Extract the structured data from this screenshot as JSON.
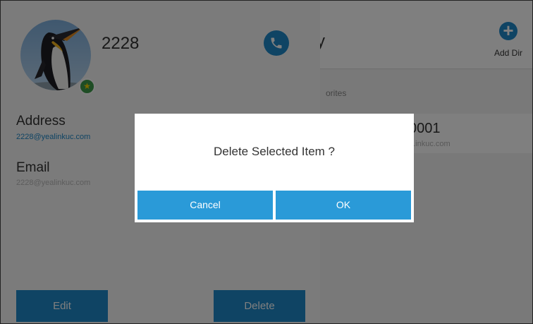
{
  "contact": {
    "name": "2228",
    "address_label": "Address",
    "address_value": "2228@yealinkuc.com",
    "email_label": "Email",
    "email_value": "2228@yealinkuc.com"
  },
  "actions": {
    "edit_label": "Edit",
    "delete_label": "Delete"
  },
  "directory": {
    "title_fragment": "ry",
    "add_label": "Add Dir",
    "tab_fragment": "orites",
    "entry_number_fragment": "0001",
    "entry_sub_fragment": "...inkuc.com"
  },
  "dialog": {
    "message": "Delete Selected Item ?",
    "cancel_label": "Cancel",
    "ok_label": "OK"
  },
  "colors": {
    "accent": "#1e88c8",
    "dialog_button": "#2a9ad8",
    "favorite_badge": "#3d9a4a"
  },
  "icons": {
    "call": "phone-icon",
    "add": "plus-icon",
    "favorite": "star-icon"
  }
}
